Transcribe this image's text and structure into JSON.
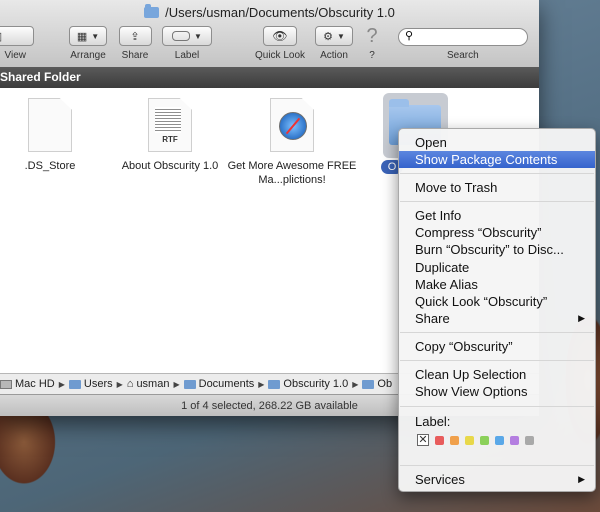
{
  "window": {
    "title": "/Users/usman/Documents/Obscurity 1.0",
    "section_header": "Shared Folder",
    "status_text": "1 of 4 selected, 268.22 GB available"
  },
  "toolbar": {
    "view_label": "View",
    "arrange_label": "Arrange",
    "share_label": "Share",
    "label_label": "Label",
    "quicklook_label": "Quick Look",
    "action_label": "Action",
    "help_label": "?",
    "search_label": "Search",
    "search_placeholder": ""
  },
  "files": [
    {
      "name": ".DS_Store",
      "icon": "blank-document-icon"
    },
    {
      "name": "About Obscurity 1.0",
      "icon": "rtf-document-icon",
      "badge": "RTF"
    },
    {
      "name": "Get More Awesome FREE Ma...plictions!",
      "icon": "safari-webloc-icon"
    },
    {
      "name": "O",
      "icon": "folder-icon",
      "selected": true
    }
  ],
  "breadcrumb": [
    {
      "label": "Mac HD",
      "icon": "hard-drive-icon"
    },
    {
      "label": "Users",
      "icon": "folder-icon"
    },
    {
      "label": "usman",
      "icon": "home-icon"
    },
    {
      "label": "Documents",
      "icon": "folder-icon"
    },
    {
      "label": "Obscurity 1.0",
      "icon": "folder-icon"
    },
    {
      "label": "Ob",
      "icon": "folder-icon"
    }
  ],
  "context_menu": {
    "items": [
      {
        "label": "Open"
      },
      {
        "label": "Show Package Contents",
        "highlighted": true
      },
      {
        "label": "Move to Trash"
      },
      {
        "label": "Get Info"
      },
      {
        "label": "Compress “Obscurity”"
      },
      {
        "label": "Burn “Obscurity” to Disc..."
      },
      {
        "label": "Duplicate"
      },
      {
        "label": "Make Alias"
      },
      {
        "label": "Quick Look “Obscurity”"
      },
      {
        "label": "Share",
        "submenu": true
      },
      {
        "label": "Copy “Obscurity”"
      },
      {
        "label": "Clean Up Selection"
      },
      {
        "label": "Show View Options"
      },
      {
        "label": "Services",
        "submenu": true
      }
    ],
    "label_heading": "Label:",
    "label_colors": [
      "#e85c5c",
      "#f0a04b",
      "#e8d84a",
      "#8bd05a",
      "#5aa8e8",
      "#b47ee0",
      "#a9a9a9"
    ],
    "highlight_color": "#3a68d0"
  }
}
